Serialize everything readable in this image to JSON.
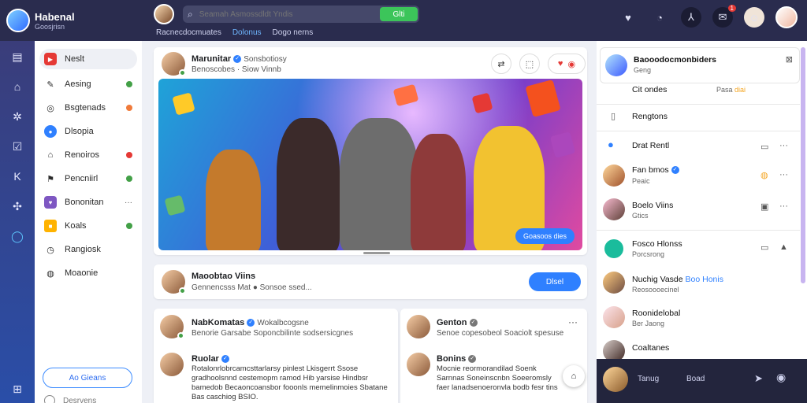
{
  "brand": {
    "title": "Habenal",
    "subtitle": "Goosjrisn"
  },
  "search": {
    "placeholder": "Seamah Asmossdldt Yndis",
    "button": "Glti"
  },
  "subnav": [
    {
      "label": "Racnecdocmuates",
      "active": false
    },
    {
      "label": "Dolonus",
      "active": true
    },
    {
      "label": "Dogo nerns",
      "active": false
    }
  ],
  "topbar": {
    "notification_count": "1"
  },
  "sidebar": {
    "items": [
      {
        "label": "Neslt",
        "icon": "play-icon",
        "indicator": "none"
      },
      {
        "label": "Aesing",
        "icon": "pencil-icon",
        "indicator": "green"
      },
      {
        "label": "Bsgtenads",
        "icon": "target-icon",
        "indicator": "red"
      },
      {
        "label": "Dlsopia",
        "icon": "chat-icon",
        "indicator": "none"
      },
      {
        "label": "Renoiros",
        "icon": "lock-icon",
        "indicator": "red"
      },
      {
        "label": "Pencniirl",
        "icon": "flag-icon",
        "indicator": "green"
      },
      {
        "label": "Bononitan",
        "icon": "heart-icon",
        "indicator": "more"
      },
      {
        "label": "Koals",
        "icon": "bag-icon",
        "indicator": "green"
      },
      {
        "label": "Rangiosk",
        "icon": "clock-icon",
        "indicator": "none"
      },
      {
        "label": "Moaonie",
        "icon": "globe-icon",
        "indicator": "none"
      }
    ],
    "cta": "Ao Gieans",
    "last_item": "Desrvens"
  },
  "post1": {
    "author": "Marunitar",
    "meta": "Sonsbotiosy",
    "sub": "Benoscobes ·  Siow  Vinnb",
    "image_button": "Goasoos dies"
  },
  "post2": {
    "author": "Maoobtao Viins",
    "sub": "Gennencsss  Mat  ●  Sonsoe ssed...",
    "button": "Dlsel"
  },
  "post3": {
    "author": "NabKomatas",
    "meta": "Wokalbcogsne",
    "sub": "Benorie  Garsabe Soponcbilinte sodsersicgnes",
    "author2": "Ruolar",
    "body": "Rotalonrlobrcamcsttarlarsy pinlest Lkisgerrt Ssose gradhoolsnnd cestemopm ramod  Hib yarsise Hindbsr bamedob Becaoncoansbor fooonls memelinmoies Sbatane Bas caschiog BSIO."
  },
  "post4": {
    "author": "Genton",
    "sub": "Senoe copesobeol Soaciolt spesuse",
    "author2": "Bonins",
    "body": "Mocnie reormorandilad Soenk Sarnnas Soneinscnbn Soeeromsly faer lanadsenoeronvla bodb fesr tins"
  },
  "rightpanel": {
    "header_name": "Baooodocmonbiders",
    "header_sub": "Geng",
    "row1_left": "Cit ondes",
    "row1_right": "Pasa",
    "row1_right_tag": "diai",
    "row2": "Rengtons",
    "contacts": [
      {
        "name": "Drat Rentl",
        "sub": ""
      },
      {
        "name": "Fan bmos",
        "sub": "Peaic"
      },
      {
        "name": "Boelo Viins",
        "sub": "Gtics"
      },
      {
        "name": "Fosco Hlonss",
        "sub": "Porcsrong"
      },
      {
        "name": "Nuchig Vasde",
        "tag": "Boo Honis",
        "sub": "Reosoooecinel"
      },
      {
        "name": "Roonidelobal",
        "sub": "Ber Jaong"
      },
      {
        "name": "Coaltanes",
        "sub": ""
      }
    ],
    "chat_name": "Tanug",
    "chat_status": "Boad"
  }
}
